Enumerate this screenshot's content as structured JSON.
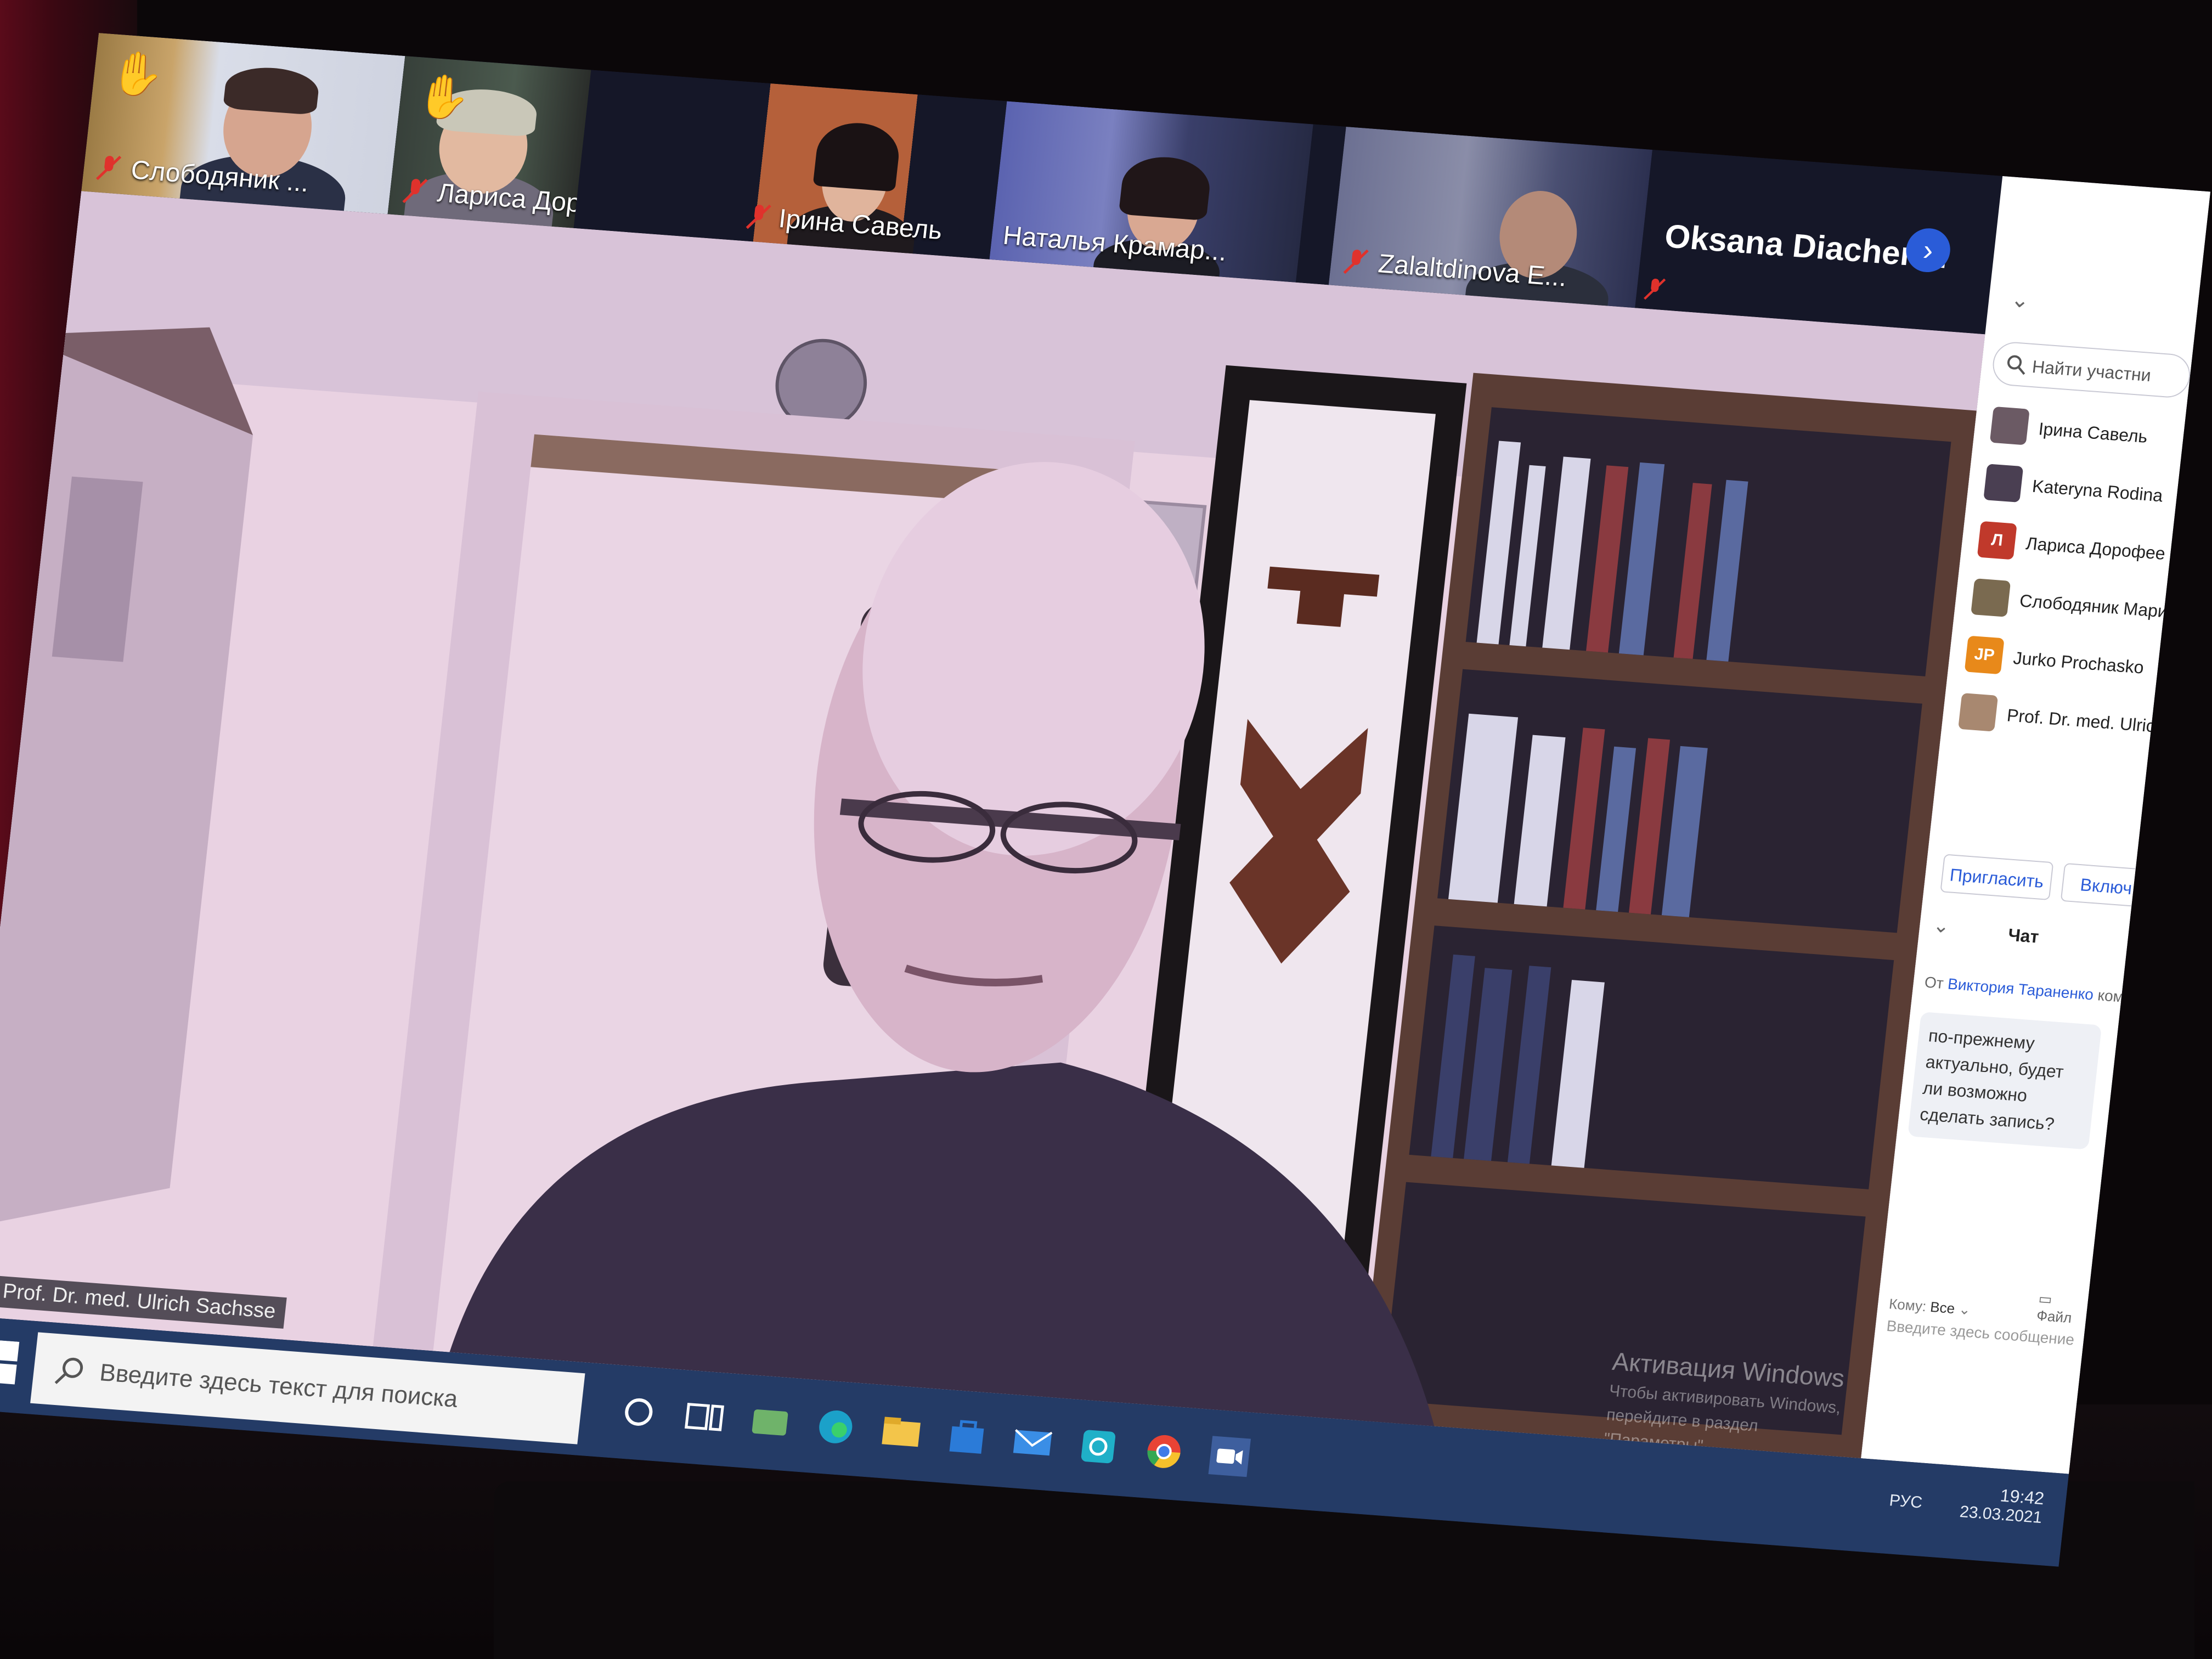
{
  "app": "Zoom",
  "participants_strip": [
    {
      "name": "Слободяник ...",
      "muted": true,
      "hand_raised": true
    },
    {
      "name": "Лариса Доро...",
      "muted": true,
      "hand_raised": true
    },
    {
      "name": "Ірина Савель",
      "muted": true,
      "hand_raised": false
    },
    {
      "name": "Наталья Крамар...",
      "muted": false,
      "hand_raised": false
    },
    {
      "name": "Zalaltdinova E...",
      "muted": true,
      "hand_raised": false
    }
  ],
  "name_only_tile": "Oksana Diachen...",
  "active_speaker": "Prof. Dr. med. Ulrich Sachsse",
  "panel": {
    "search_placeholder": "Найти участни",
    "participants": [
      {
        "name": "Ірина Савель",
        "initials": "",
        "color": "#6b5a64"
      },
      {
        "name": "Kateryna Rodina",
        "initials": "",
        "color": "#4a3f52"
      },
      {
        "name": "Лариса Дорофее",
        "initials": "Л",
        "color": "#c0392b"
      },
      {
        "name": "Слободяник Мари",
        "initials": "",
        "color": "#7a6a50"
      },
      {
        "name": "Jurko Prochasko",
        "initials": "JP",
        "color": "#e8891a"
      },
      {
        "name": "Prof. Dr. med. Ulrich Sa",
        "initials": "",
        "color": "#a88870"
      }
    ],
    "invite_label": "Пригласить",
    "unmute_label": "Включ",
    "chat_title": "Чат",
    "chat_from_prefix": "От",
    "chat_sender": "Виктория Тараненко",
    "chat_to": "кому Все:",
    "chat_message": "по-прежнему актуально, будет ли возможно сделать запись?",
    "to_label": "Кому:",
    "to_value": "Все",
    "file_label": "Файл",
    "input_placeholder": "Введите здесь сообщение"
  },
  "watermark": {
    "title": "Активация Windows",
    "line1": "Чтобы активировать Windows, перейдите в раздел",
    "line2": "\"Параметры\"."
  },
  "taskbar": {
    "search_placeholder": "Введите здесь текст для поиска",
    "language": "РУС",
    "time": "19:42",
    "date": "23.03.2021"
  },
  "colors": {
    "accent": "#2a5cd8",
    "taskbar": "#243b66",
    "strip": "#151728"
  }
}
